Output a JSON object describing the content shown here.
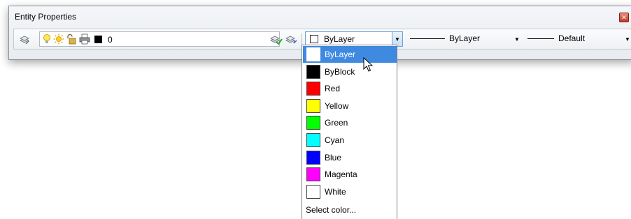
{
  "window": {
    "title": "Entity Properties"
  },
  "toolbar": {
    "layer": {
      "name": "0",
      "color": "#000000"
    },
    "color": {
      "selected": "ByLayer"
    },
    "linetype": {
      "selected": "ByLayer"
    },
    "lineweight": {
      "selected": "Default"
    }
  },
  "color_dropdown": {
    "items": [
      {
        "label": "ByLayer",
        "color": "#ffffff",
        "selected": true
      },
      {
        "label": "ByBlock",
        "color": "#000000"
      },
      {
        "label": "Red",
        "color": "#ff0000"
      },
      {
        "label": "Yellow",
        "color": "#ffff00"
      },
      {
        "label": "Green",
        "color": "#00ff00"
      },
      {
        "label": "Cyan",
        "color": "#00ffff"
      },
      {
        "label": "Blue",
        "color": "#0000ff"
      },
      {
        "label": "Magenta",
        "color": "#ff00ff"
      },
      {
        "label": "White",
        "color": "#ffffff"
      }
    ],
    "more_label": "Select color..."
  },
  "icons": {
    "layer_manager": "layer-stack-icon",
    "on_off": "lightbulb-icon",
    "freeze": "sun-icon",
    "lock": "padlock-icon",
    "plot": "printer-icon",
    "make_current": "layer-check-icon",
    "layer_previous": "layer-previous-icon",
    "close": "close-icon",
    "cursor": "mouse-pointer-icon"
  }
}
